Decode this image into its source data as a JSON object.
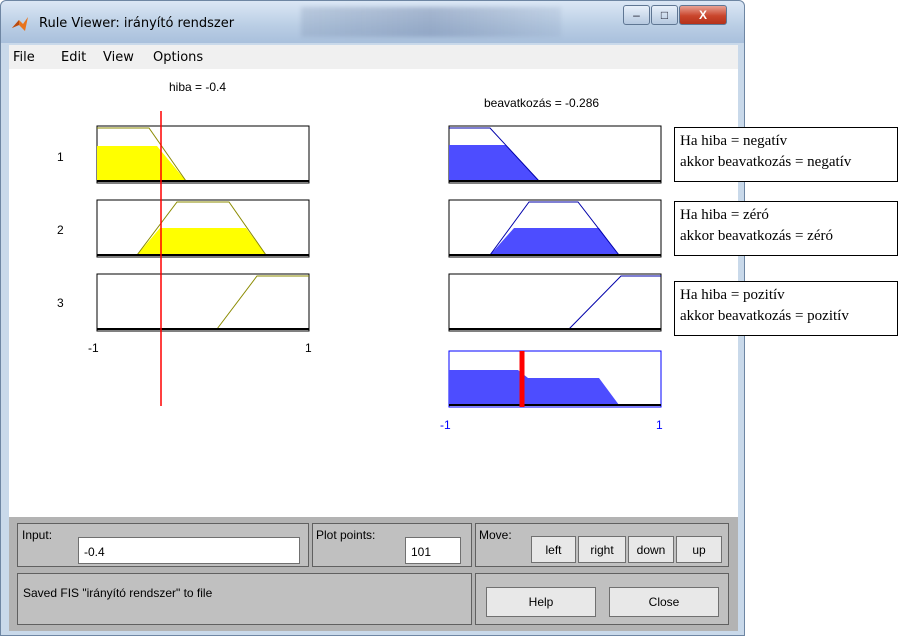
{
  "window": {
    "title": "Rule Viewer: irányító rendszer",
    "controls": {
      "minimize": "–",
      "maximize": "□",
      "close": "X"
    }
  },
  "menu": [
    "File",
    "Edit",
    "View",
    "Options"
  ],
  "plot": {
    "input_title": "hiba = -0.4",
    "output_title": "beavatkozás = -0.286",
    "rule_numbers": [
      "1",
      "2",
      "3"
    ],
    "input_axis": {
      "min_label": "-1",
      "max_label": "1"
    },
    "output_axis": {
      "min_label": "-1",
      "max_label": "1"
    },
    "input_value": -0.4,
    "output_value": -0.286,
    "input_color": "#ffff00",
    "output_color": "#4d4dff",
    "cursor_color": "#ff0000"
  },
  "rules_text": [
    {
      "line1": "Ha hiba = negatív",
      "line2": "akkor beavatkozás = negatív"
    },
    {
      "line1": "Ha hiba = zéró",
      "line2": "akkor beavatkozás = zéró"
    },
    {
      "line1": "Ha hiba = pozitív",
      "line2": "akkor beavatkozás = pozitív"
    }
  ],
  "controls": {
    "input_label": "Input:",
    "input_value": "-0.4",
    "plot_points_label": "Plot points:",
    "plot_points_value": "101",
    "move_label": "Move:",
    "move_buttons": [
      "left",
      "right",
      "down",
      "up"
    ],
    "status": "Saved FIS \"irányító rendszer\" to file",
    "help_label": "Help",
    "close_label": "Close"
  }
}
